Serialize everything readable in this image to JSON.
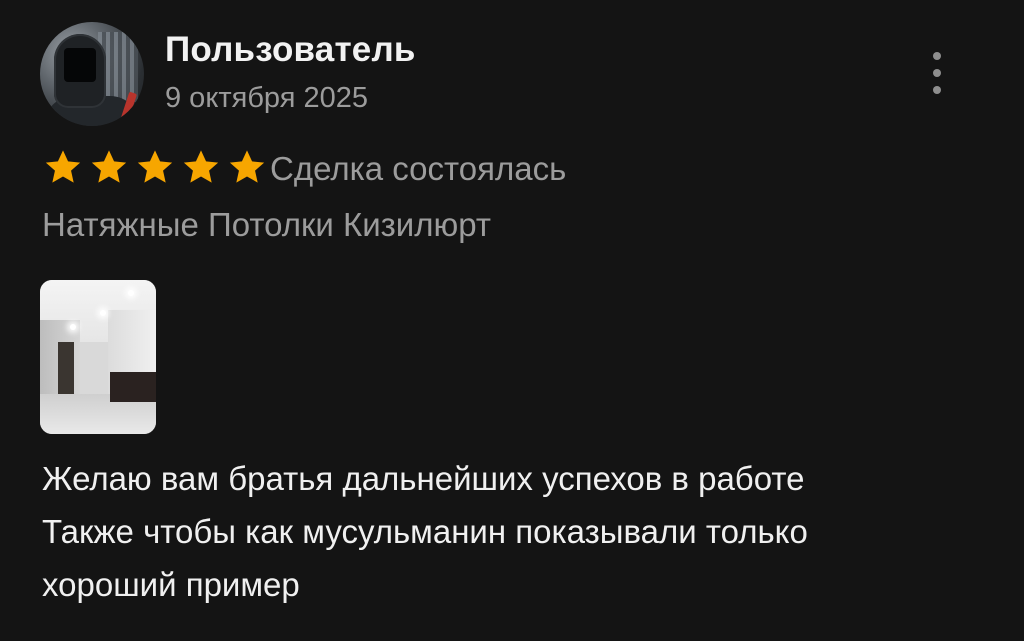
{
  "review": {
    "user_name": "Пользователь",
    "date": "9 октября 2025",
    "rating": 5,
    "rating_max": 5,
    "deal_status": "Сделка состоялась",
    "company": "Натяжные Потолки Кизилюрт",
    "text_lines": [
      "Желаю вам братья дальнейших успехов в работе",
      "Также чтобы как мусульманин показывали только",
      "хороший пример"
    ]
  },
  "icons": {
    "star": "star-icon",
    "more": "more-vertical-icon"
  },
  "colors": {
    "background": "#141414",
    "star": "#f7a600",
    "secondary_text": "#9c9c9c",
    "primary_text": "#f0f0f0"
  }
}
